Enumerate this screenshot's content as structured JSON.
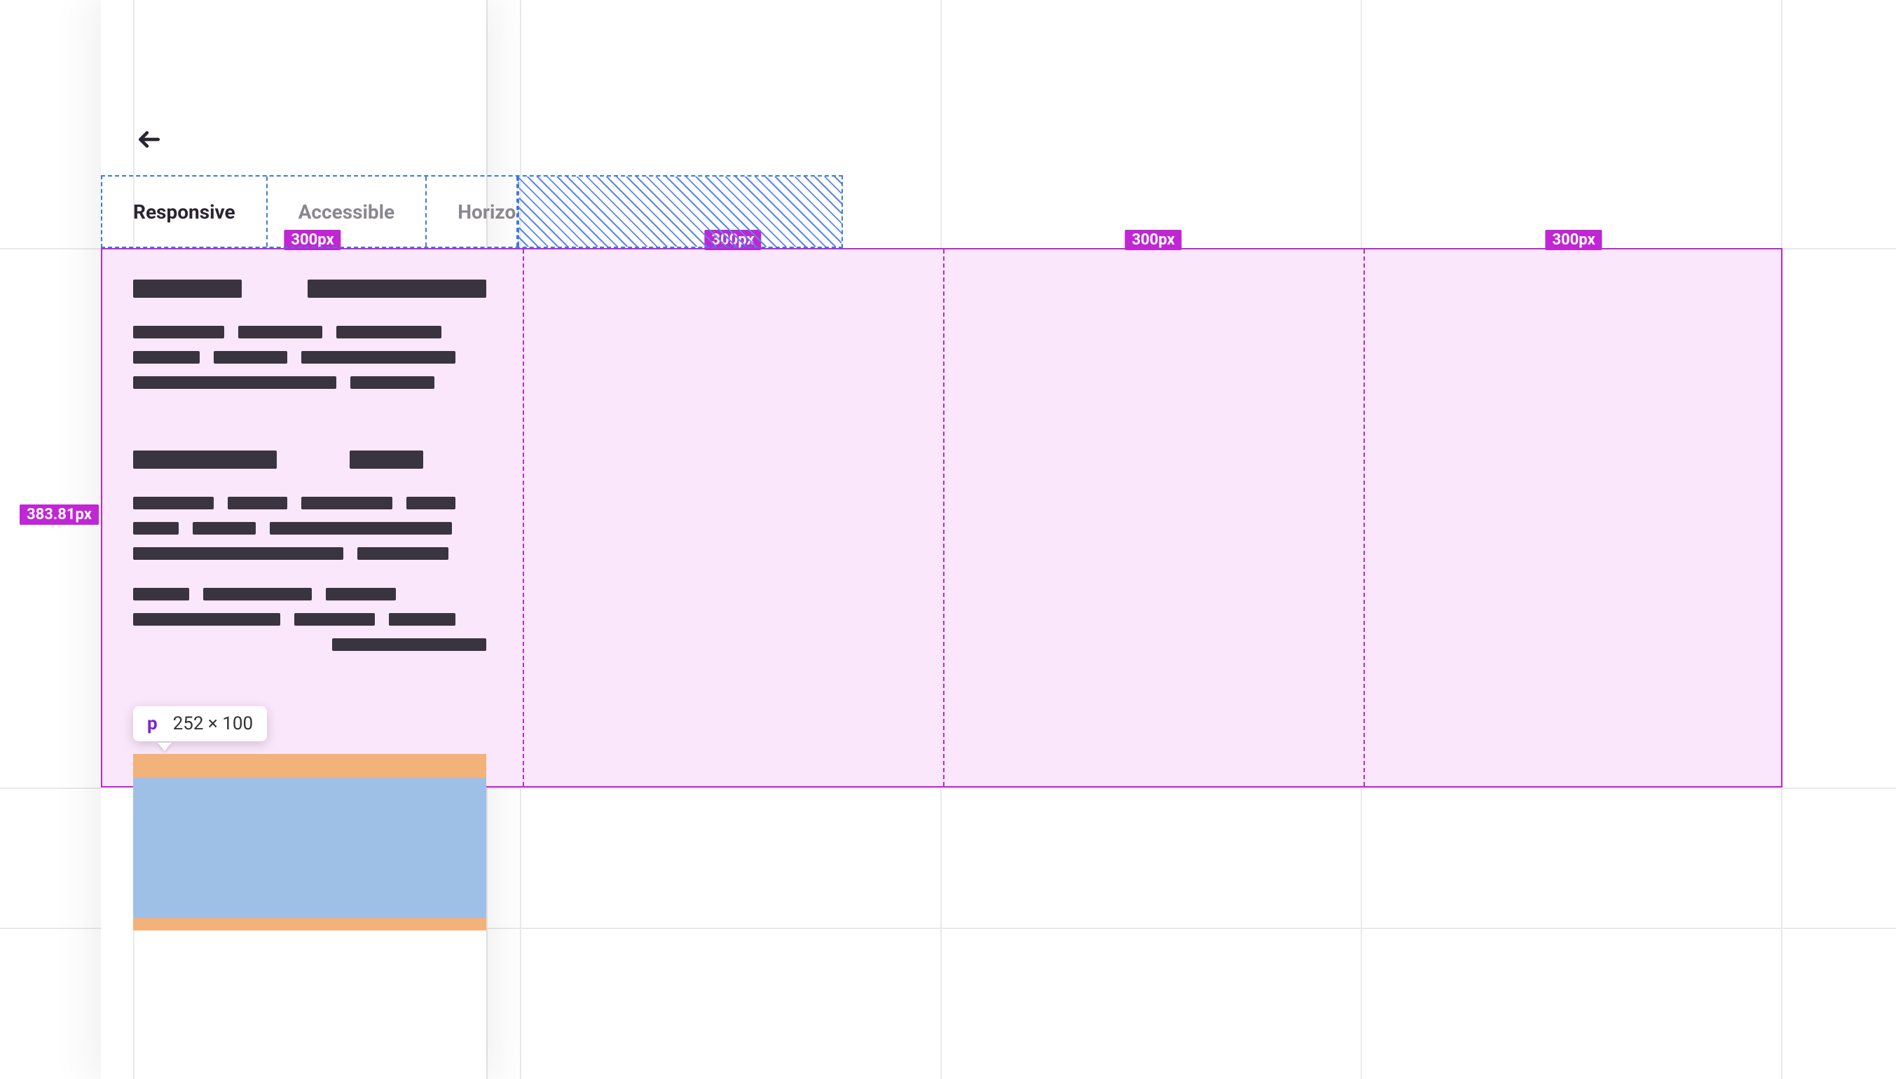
{
  "tabs": {
    "items": [
      {
        "label": "Responsive",
        "active": true
      },
      {
        "label": "Accessible",
        "active": false
      },
      {
        "label": "Horizontal",
        "active": false,
        "truncated": true
      }
    ]
  },
  "selection": {
    "column_width_label": "300px",
    "height_label": "383.81px",
    "columns": 4
  },
  "tooltip": {
    "tag": "p",
    "dimensions": "252 × 100"
  },
  "colors": {
    "magenta": "#c026d3",
    "magenta_fill": "#fbe7fb",
    "blue_dash": "#3e7bd6",
    "box_content": "#9ec0e6",
    "box_margin": "#f2b27a"
  }
}
